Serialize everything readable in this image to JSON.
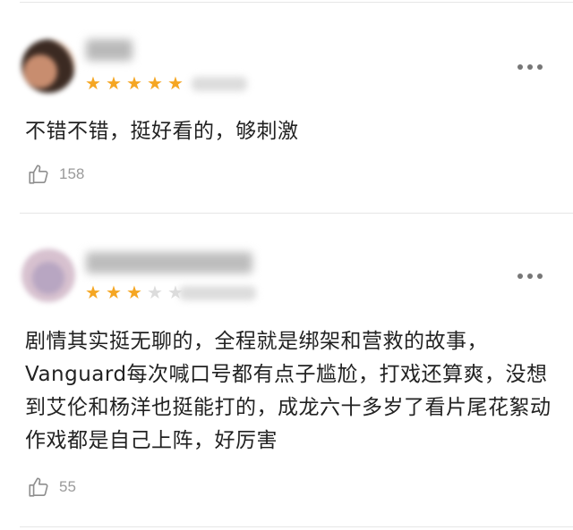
{
  "reviews": [
    {
      "rating": 5,
      "rating_max": 5,
      "text": "不错不错，挺好看的，够刺激",
      "likes": "158",
      "avatar_colors": [
        "#3b2a22",
        "#c88d6f",
        "#e9c9b4"
      ]
    },
    {
      "rating": 3,
      "rating_max": 5,
      "text": "剧情其实挺无聊的，全程就是绑架和营救的故事，Vanguard每次喊口号都有点子尴尬，打戏还算爽，没想到艾伦和杨洋也挺能打的，成龙六十多岁了看片尾花絮动作戏都是自己上阵，好厉害",
      "likes": "55",
      "avatar_colors": [
        "#d7c1cf",
        "#b8a6c2",
        "#efe3ea"
      ]
    }
  ],
  "icons": {
    "like": "thumbs-up-icon",
    "more": "more-dots-icon",
    "star": "star-icon"
  },
  "colors": {
    "star_on": "#f5a623",
    "star_off": "#dcdcdc",
    "text": "#222222",
    "meta": "#9a9a9a",
    "divider": "#e6e6e6"
  }
}
